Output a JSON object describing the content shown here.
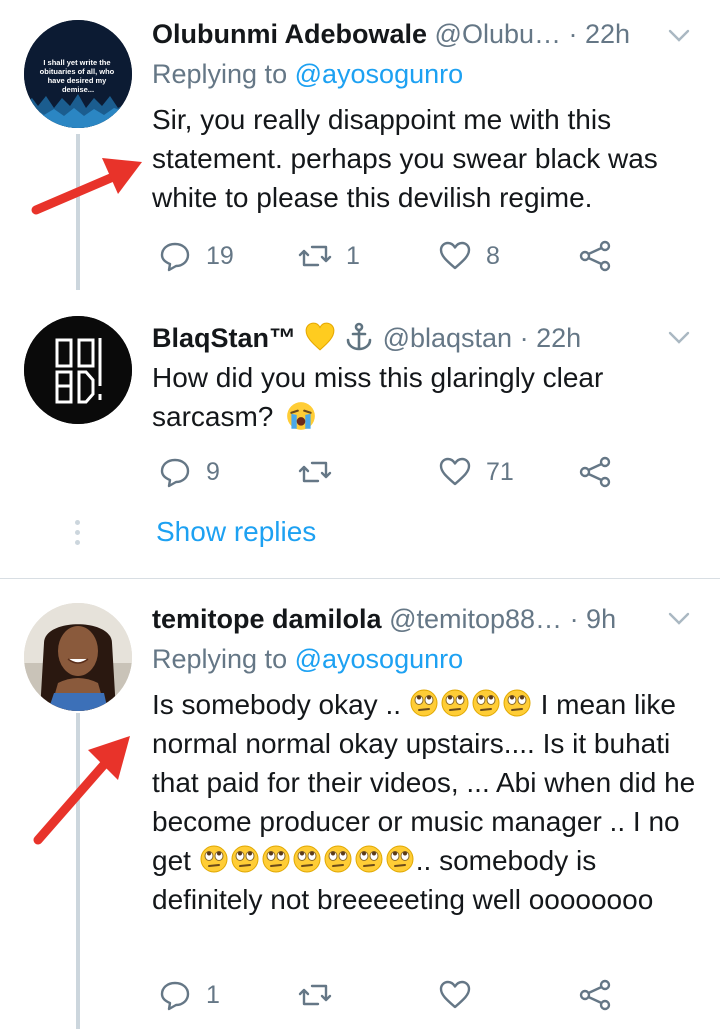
{
  "tweets": [
    {
      "name": "Olubunmi Adebowale",
      "handle": "@Olubu…",
      "time": "· 22h",
      "replying_label": "Replying to",
      "replying_handle": "@ayosogunro",
      "text": "Sir, you really disappoint me with this statement. perhaps you swear black was white to please this devilish regime.",
      "avatar_text": "I shall yet write the obituaries of all, who have desired my demise...",
      "counts": {
        "reply": "19",
        "retweet": "1",
        "like": "8"
      }
    },
    {
      "name": "BlaqStan™",
      "handle": "@blaqstan",
      "time": "· 22h",
      "text_line1": "How did you miss this glaringly clear",
      "text_line2": "sarcasm?",
      "avatar_text": "GAAD BAD!",
      "counts": {
        "reply": "9",
        "retweet": "",
        "like": "71"
      }
    },
    {
      "name": "temitope damilola",
      "handle": "@temitop88…",
      "time": "· 9h",
      "replying_label": "Replying to",
      "replying_handle": "@ayosogunro",
      "text_p1": "Is somebody okay ..",
      "text_p2": "I mean",
      "text_p3": "like normal normal okay upstairs.... Is it buhati that paid for their videos, ... Abi when did he become producer or music manager .. I no get",
      "text_p4": "..",
      "text_p5": "somebody is definitely not breeeeeting well oooooooo",
      "counts": {
        "reply": "1",
        "retweet": "",
        "like": ""
      }
    }
  ],
  "show_replies": "Show replies",
  "colors": {
    "accent": "#1da1f2",
    "muted": "#657786",
    "arrow": "#e8332a"
  }
}
